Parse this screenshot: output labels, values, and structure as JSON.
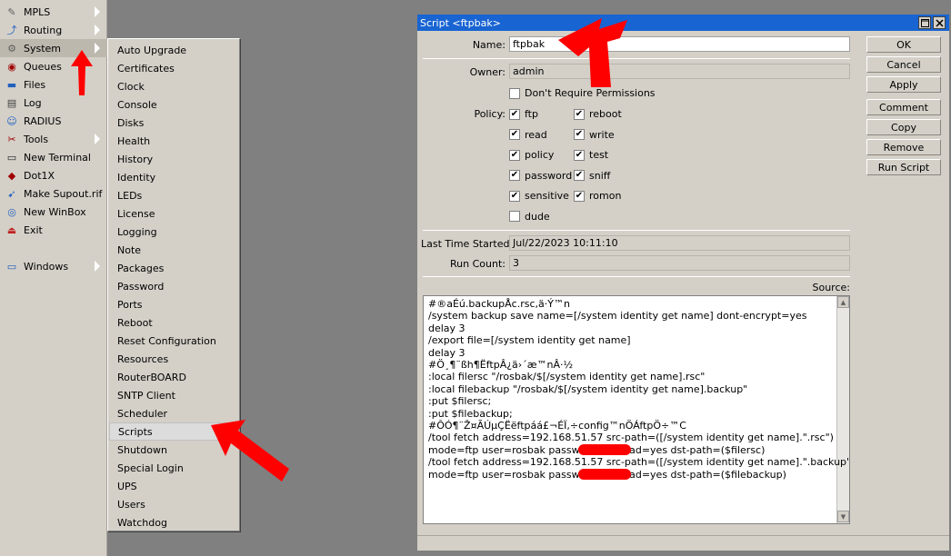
{
  "left_menu": {
    "items": [
      {
        "label": "MPLS",
        "icon": "mpls-icon",
        "submenu": true
      },
      {
        "label": "Routing",
        "icon": "routing-icon",
        "submenu": true
      },
      {
        "label": "System",
        "icon": "gear-icon",
        "submenu": true
      },
      {
        "label": "Queues",
        "icon": "queues-icon",
        "submenu": false
      },
      {
        "label": "Files",
        "icon": "folder-icon",
        "submenu": false
      },
      {
        "label": "Log",
        "icon": "log-icon",
        "submenu": false
      },
      {
        "label": "RADIUS",
        "icon": "users-icon",
        "submenu": false
      },
      {
        "label": "Tools",
        "icon": "tools-icon",
        "submenu": true
      },
      {
        "label": "New Terminal",
        "icon": "terminal-icon",
        "submenu": false
      },
      {
        "label": "Dot1X",
        "icon": "dot1x-icon",
        "submenu": false
      },
      {
        "label": "Make Supout.rif",
        "icon": "supout-icon",
        "submenu": false
      },
      {
        "label": "New WinBox",
        "icon": "winbox-icon",
        "submenu": false
      },
      {
        "label": "Exit",
        "icon": "exit-icon",
        "submenu": false
      },
      {
        "label": "Windows",
        "icon": "windows-icon",
        "submenu": true
      }
    ]
  },
  "system_submenu": {
    "items": [
      "Auto Upgrade",
      "Certificates",
      "Clock",
      "Console",
      "Disks",
      "Health",
      "History",
      "Identity",
      "LEDs",
      "License",
      "Logging",
      "Note",
      "Packages",
      "Password",
      "Ports",
      "Reboot",
      "Reset Configuration",
      "Resources",
      "RouterBOARD",
      "SNTP Client",
      "Scheduler",
      "Scripts",
      "Shutdown",
      "Special Login",
      "UPS",
      "Users",
      "Watchdog"
    ],
    "highlighted": "Scripts"
  },
  "dialog": {
    "title": "Script <ftpbak>",
    "name_label": "Name:",
    "name_value": "ftpbak",
    "owner_label": "Owner:",
    "owner_value": "admin",
    "dont_require_label": "Don't Require Permissions",
    "dont_require_checked": false,
    "policy_label": "Policy:",
    "policies": [
      {
        "label": "ftp",
        "checked": true
      },
      {
        "label": "reboot",
        "checked": true
      },
      {
        "label": "read",
        "checked": true
      },
      {
        "label": "write",
        "checked": true
      },
      {
        "label": "policy",
        "checked": true
      },
      {
        "label": "test",
        "checked": true
      },
      {
        "label": "password",
        "checked": true
      },
      {
        "label": "sniff",
        "checked": true
      },
      {
        "label": "sensitive",
        "checked": true
      },
      {
        "label": "romon",
        "checked": true
      },
      {
        "label": "dude",
        "checked": false
      }
    ],
    "last_time_label": "Last Time Started:",
    "last_time_value": "Jul/22/2023 10:11:10",
    "run_count_label": "Run Count:",
    "run_count_value": "3",
    "source_label": "Source:",
    "source_lines": [
      "#®aÉú.backupÅc.rsc,ä·Ý™n",
      "/system backup save name=[/system identity get name] dont-encrypt=yes",
      "delay 3",
      "/export file=[/system identity get name]",
      "delay 3",
      "#Ö¸¶¨ßh¶ËftpÂ¿ä›´æ™nÂ·½",
      ":local filersc \"/rosbak/$[/system identity get name].rsc\"",
      ":local filebackup \"/rosbak/$[/system identity get name].backup\"",
      ":put $filersc;",
      ":put $filebackup;",
      "#ÔÓ¶¨Ž¤ÃÚµÇËëftpáá£¬ÉÏ,÷config™nÖÁftpÖ÷™C",
      "/tool fetch address=192.168.51.57 src-path=([/system identity get name].\".rsc\")",
      "mode=ftp user=rosbak password=              upload=yes dst-path=($filersc)",
      "/tool fetch address=192.168.51.57 src-path=([/system identity get name].\".backup\")",
      "mode=ftp user=rosbak password=              upload=yes dst-path=($filebackup)"
    ],
    "buttons": [
      "OK",
      "Cancel",
      "Apply",
      "Comment",
      "Copy",
      "Remove",
      "Run Script"
    ]
  },
  "colors": {
    "titlebar": "#1864d2",
    "panel": "#d4d0c8",
    "annotation_arrow": "#ff0000"
  }
}
